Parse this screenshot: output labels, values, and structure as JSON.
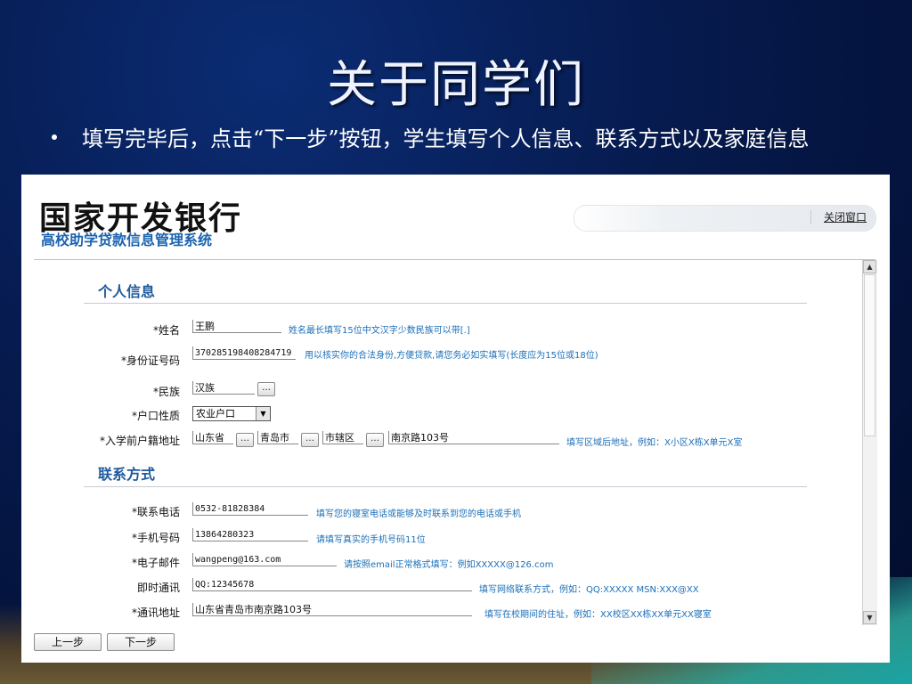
{
  "slide": {
    "title": "关于同学们",
    "bullet": "填写完毕后，点击“下一步”按钮，学生填写个人信息、联系方式以及家庭信息"
  },
  "app": {
    "bank_name": "国家开发银行",
    "system_name": "高校助学贷款信息管理系统",
    "close_label": "关闭窗口"
  },
  "sections": {
    "personal": "个人信息",
    "contact": "联系方式"
  },
  "personal": {
    "name": {
      "label": "*姓名",
      "value": "王鹏",
      "hint": "姓名最长填写15位中文汉字少数民族可以带[.]"
    },
    "id": {
      "label": "*身份证号码",
      "value": "370285198408284719",
      "hint": "用以核实你的合法身份,方便贷款,请您务必如实填写(长度应为15位或18位)"
    },
    "ethnic": {
      "label": "*民族",
      "value": "汉族"
    },
    "hukou": {
      "label": "*户口性质",
      "value": "农业户口"
    },
    "address": {
      "label": "*入学前户籍地址",
      "province": "山东省",
      "city": "青岛市",
      "district": "市辖区",
      "detail": "南京路103号",
      "hint": "填写区域后地址，例如：X小区X栋X单元X室"
    }
  },
  "contact": {
    "phone": {
      "label": "*联系电话",
      "value": "0532-81828384",
      "hint": "填写您的寝室电话或能够及时联系到您的电话或手机"
    },
    "mobile": {
      "label": "*手机号码",
      "value": "13864280323",
      "hint": "请填写真实的手机号码11位"
    },
    "email": {
      "label": "*电子邮件",
      "value": "wangpeng@163.com",
      "hint": "请按照email正常格式填写：例如XXXXX@126.com"
    },
    "im": {
      "label": "即时通讯",
      "value": "QQ:12345678",
      "hint": "填写网络联系方式，例如：QQ:XXXXX MSN:XXX@XX"
    },
    "mail_address": {
      "label": "*通讯地址",
      "value": "山东省青岛市南京路103号",
      "hint": "填写在校期间的住址，例如：XX校区XX栋XX单元XX寝室"
    }
  },
  "icons": {
    "dots": "…",
    "scroll_up": "▲",
    "scroll_down": "▼",
    "select_arrow": "▼"
  },
  "buttons": {
    "prev": "上一步",
    "next": "下一步"
  }
}
